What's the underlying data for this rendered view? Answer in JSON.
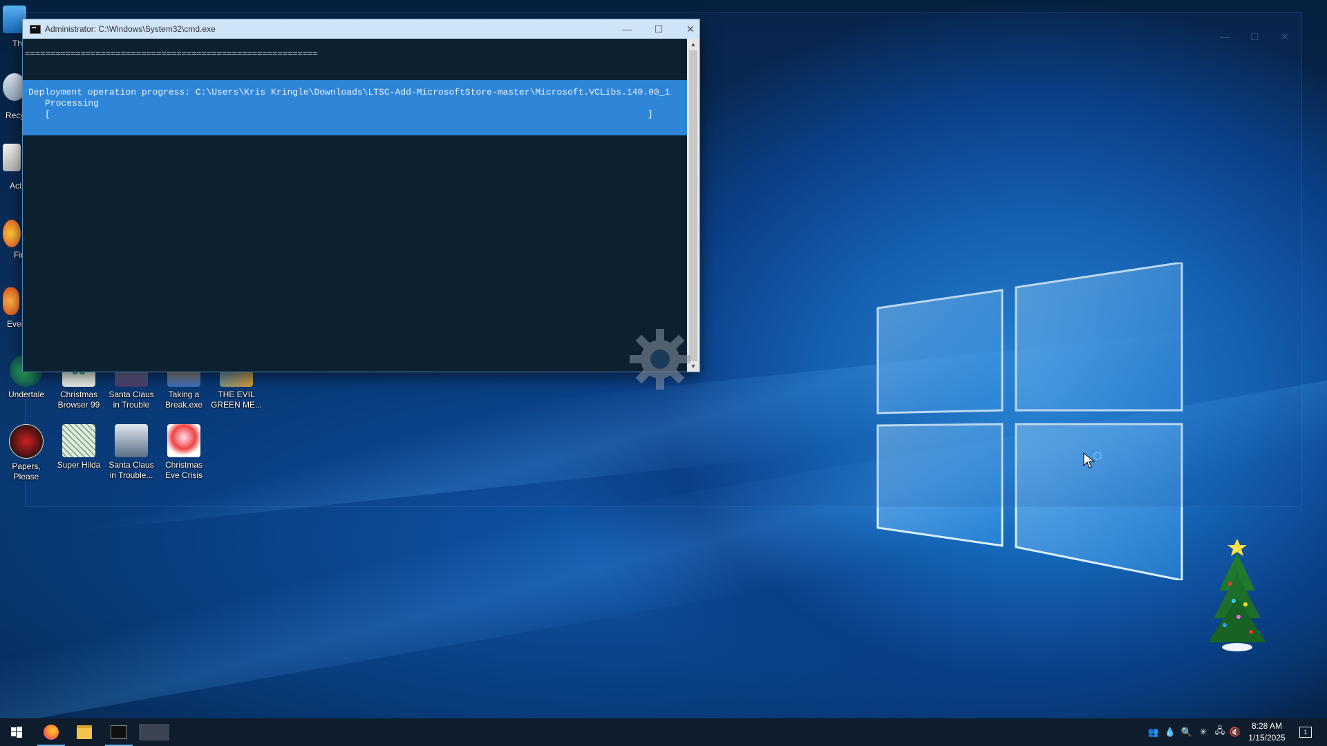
{
  "cmd_window": {
    "title": "Administrator: C:\\Windows\\System32\\cmd.exe",
    "separator": "==========================================================",
    "progress_line1": "Deployment operation progress: C:\\Users\\Kris Kringle\\Downloads\\LTSC-Add-MicrosoftStore-master\\Microsoft.VCLibs.140.00_1",
    "progress_line2": "Processing",
    "progress_line3_left": "[",
    "progress_line3_right": "]",
    "minimize_glyph": "—",
    "maximize_glyph": "☐",
    "close_glyph": "✕"
  },
  "desktop": {
    "partial_icons": [
      {
        "label": "Thi"
      },
      {
        "label": "Recy"
      },
      {
        "label": "Acti"
      },
      {
        "label": "Fir"
      },
      {
        "label": "Even"
      }
    ],
    "icons": [
      {
        "label": "Undertale",
        "icon": "undertale-icon"
      },
      {
        "label": "Christmas Browser 99",
        "icon": "christmas-browser-icon",
        "badge": "99"
      },
      {
        "label": "Santa Claus in Trouble",
        "icon": "santa-trouble-icon"
      },
      {
        "label": "Taking a Break.exe",
        "icon": "taking-break-icon"
      },
      {
        "label": "THE EVIL GREEN ME...",
        "icon": "evil-green-icon"
      },
      {
        "label": "Papers, Please",
        "icon": "papers-please-icon"
      },
      {
        "label": "Super Hilda",
        "icon": "super-hilda-icon"
      },
      {
        "label": "Santa Claus in Trouble...",
        "icon": "santa-trouble-2-icon"
      },
      {
        "label": "Christmas Eve Crisis",
        "icon": "christmas-eve-icon"
      }
    ]
  },
  "taskbar": {
    "apps": [
      {
        "name": "start",
        "icon": "windows-start-icon"
      },
      {
        "name": "firefox",
        "icon": "firefox-icon"
      },
      {
        "name": "file-explorer",
        "icon": "folder-icon"
      },
      {
        "name": "command-prompt",
        "icon": "terminal-icon"
      },
      {
        "name": "open-window",
        "icon": "window-thumbnail-icon"
      }
    ],
    "tray_icons": [
      "people-icon",
      "droplet-icon",
      "search-tray-icon",
      "sparkle-icon",
      "network-icon",
      "volume-muted-icon"
    ],
    "time": "8:28 AM",
    "date": "1/15/2025",
    "notification_badge": "1"
  },
  "colors": {
    "accent": "#2f86d8",
    "console_bg": "#0c2030",
    "titlebar": "#cfe4f6",
    "taskbar": "#0f1c2b"
  }
}
